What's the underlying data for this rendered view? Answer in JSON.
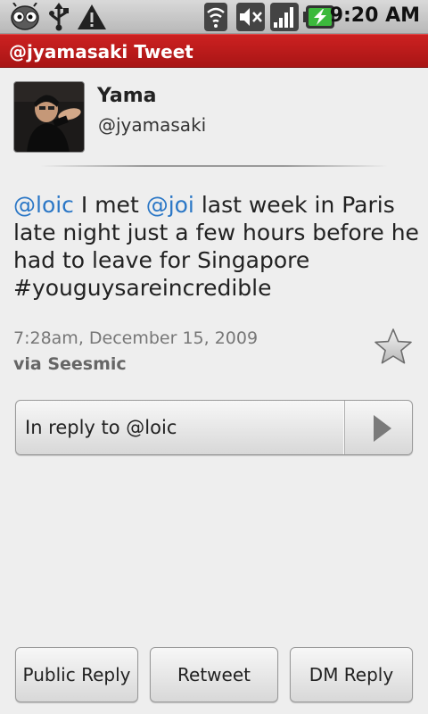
{
  "status_bar": {
    "time": "9:20 AM",
    "icons": [
      "android-robot-icon",
      "usb-icon",
      "warning-icon",
      "wifi-icon",
      "mute-icon",
      "signal-icon",
      "battery-charging-icon"
    ]
  },
  "title_bar": {
    "title": "@jyamasaki Tweet",
    "color": "#b81818"
  },
  "profile": {
    "name": "Yama",
    "handle": "@jyamasaki",
    "avatar_icon": "avatar-photo"
  },
  "tweet": {
    "mention_1": "@loic",
    "text_1": " I met ",
    "mention_2": "@joi",
    "text_2": " last week in Paris late night just a few hours before he had to leave for Singapore #youguysareincredible",
    "date": "7:28am, December 15, 2009",
    "via": "via Seesmic",
    "favorite_icon": "star-icon",
    "mention_color": "#2b77c6"
  },
  "reply_to": {
    "label": "In reply to @loic",
    "icon": "arrow-right-icon"
  },
  "actions": {
    "public_reply": "Public Reply",
    "retweet": "Retweet",
    "dm_reply": "DM Reply"
  }
}
